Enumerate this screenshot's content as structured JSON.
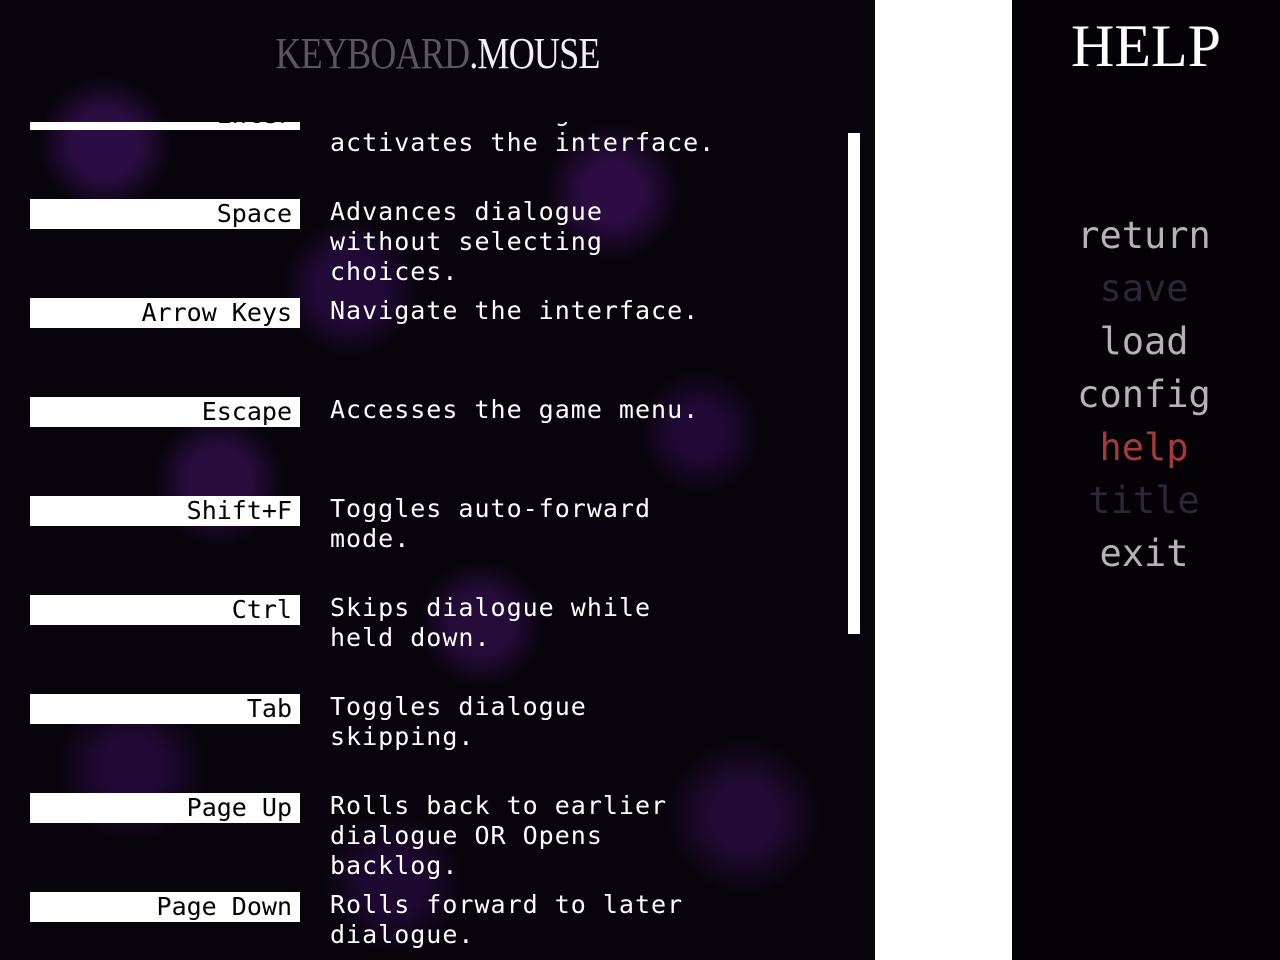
{
  "header": {
    "title_left": "KEYBOARD",
    "title_sep": ".",
    "title_right": "MOUSE"
  },
  "bindings": [
    {
      "key": "Enter",
      "desc": "Advances dialogue and\nactivates the interface."
    },
    {
      "key": "Space",
      "desc": "Advances dialogue\nwithout selecting\nchoices."
    },
    {
      "key": "Arrow Keys",
      "desc": "Navigate the interface."
    },
    {
      "key": "Escape",
      "desc": "Accesses the game menu."
    },
    {
      "key": "Shift+F",
      "desc": "Toggles auto-forward\nmode."
    },
    {
      "key": "Ctrl",
      "desc": "Skips dialogue while\nheld down."
    },
    {
      "key": "Tab",
      "desc": "Toggles dialogue\nskipping."
    },
    {
      "key": "Page Up",
      "desc": "Rolls back to earlier\ndialogue OR Opens\nbacklog."
    },
    {
      "key": "Page Down",
      "desc": "Rolls forward to later\ndialogue."
    }
  ],
  "menu": {
    "title": "HELP",
    "items": [
      {
        "label": "return",
        "color": "#b4b2b6"
      },
      {
        "label": "save",
        "color": "#2a2833"
      },
      {
        "label": "load",
        "color": "#b4b2b6"
      },
      {
        "label": "config",
        "color": "#b4b2b6"
      },
      {
        "label": "help",
        "color": "#a63a3a"
      },
      {
        "label": "title",
        "color": "#2a2833"
      },
      {
        "label": "exit",
        "color": "#b4b2b6"
      }
    ]
  }
}
